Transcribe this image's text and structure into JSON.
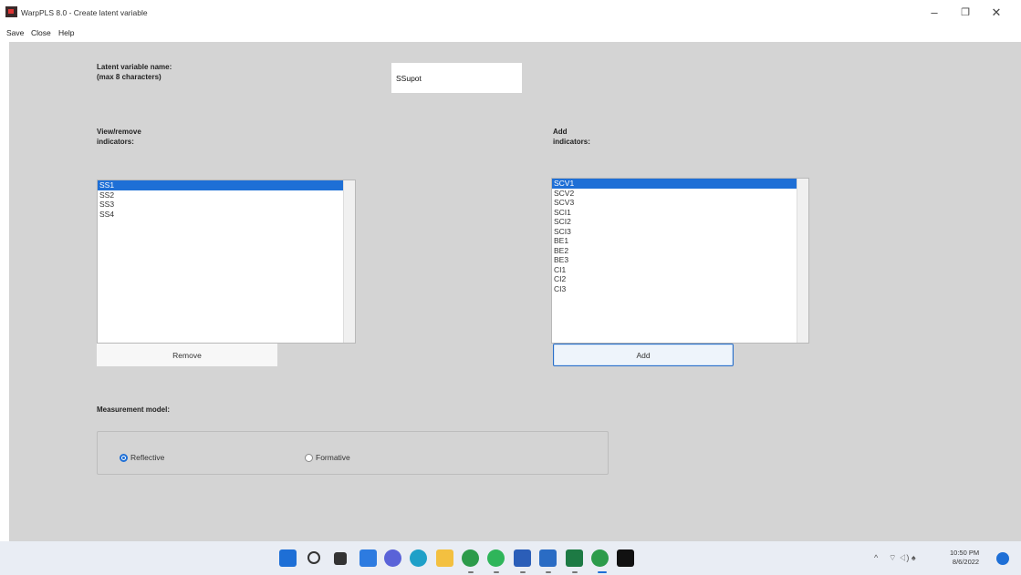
{
  "window": {
    "title": "WarpPLS 8.0 - Create latent variable",
    "minimize_glyph": "–",
    "maximize_glyph": "❐",
    "close_glyph": "✕"
  },
  "menu": [
    "Save",
    "Close",
    "Help"
  ],
  "form": {
    "lv_name_label": "Latent variable name:\n(max 8 characters)",
    "lv_name_value": "SSupot",
    "view_remove_label": "View/remove\nindicators:",
    "add_label": "Add\nindicators:",
    "current_indicators": [
      "SS1",
      "SS2",
      "SS3",
      "SS4"
    ],
    "available_indicators": [
      "SCV1",
      "SCV2",
      "SCV3",
      "SCI1",
      "SCI2",
      "SCI3",
      "BE1",
      "BE2",
      "BE3",
      "CI1",
      "CI2",
      "CI3"
    ],
    "remove_button": "Remove",
    "add_button": "Add",
    "measurement_label": "Measurement model:",
    "reflective_label": "Reflective",
    "formative_label": "Formative",
    "selected_model": "Reflective"
  },
  "taskbar": {
    "icons": [
      "windows-start-icon",
      "search-icon",
      "task-view-icon",
      "widgets-icon",
      "chat-icon",
      "edge-icon",
      "file-explorer-icon",
      "chrome-icon",
      "chrome-alt-icon",
      "word-icon",
      "photos-icon",
      "excel-icon",
      "chrome-badge-icon",
      "warppls-icon"
    ],
    "tray_chevron": "^",
    "tray_symbols": "⌔ ◁) ♠",
    "time": "10:50 PM",
    "date": "8/6/2022"
  },
  "colors": {
    "accent": "#1e6fd6",
    "client_bg": "#d4d4d4",
    "taskbar_bg": "#e9edf4"
  }
}
